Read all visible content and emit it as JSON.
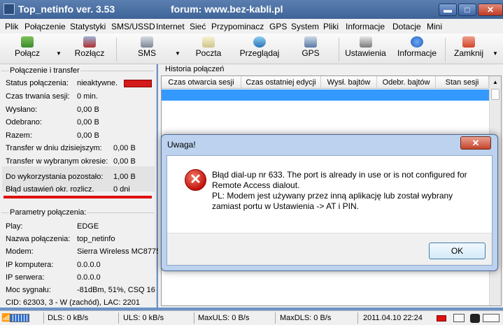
{
  "window": {
    "title": "Top_netinfo ver. 3.53",
    "forum": "forum: www.bez-kabli.pl",
    "min_label": "▬",
    "max_label": "□",
    "close_label": "✕"
  },
  "menu": [
    "Plik",
    "Połączenie",
    "Statystyki",
    "SMS/USSD",
    "Internet",
    "Sieć",
    "Przypominacz",
    "GPS",
    "System",
    "Pliki",
    "Informacje",
    "Dotacje",
    "Mini"
  ],
  "toolbar": {
    "connect": "Połącz",
    "disconnect": "Rozłącz",
    "sms": "SMS",
    "mail": "Poczta",
    "browse": "Przeglądaj",
    "gps": "GPS",
    "settings": "Ustawienia",
    "info": "Informacje",
    "close": "Zamknij"
  },
  "connection": {
    "group_title": "Połączenie i transfer",
    "status_label": "Status połączenia:",
    "status_value": "nieaktywne.",
    "duration_label": "Czas trwania sesji:",
    "duration_value": "0 min.",
    "sent_label": "Wysłano:",
    "sent_value": "0,00 B",
    "received_label": "Odebrano:",
    "received_value": "0,00 B",
    "total_label": "Razem:",
    "total_value": "0,00 B",
    "today_label": "Transfer w dniu dzisiejszym:",
    "today_value": "0,00 B",
    "period_label": "Transfer w wybranym okresie:",
    "period_value": "0,00 B",
    "remaining_label": "Do wykorzystania pozostało:",
    "remaining_value": "1,00 B",
    "error_label": "Błąd ustawień okr. rozlicz.",
    "error_value": "0 dni",
    "status_color": "#d41a1a"
  },
  "params": {
    "group_title": "Parametry połączenia:",
    "play_label": "Play:",
    "play_value": "EDGE",
    "name_label": "Nazwa połączenia:",
    "name_value": "top_netinfo",
    "modem_label": "Modem:",
    "modem_value": "Sierra Wireless MC8775",
    "ip_pc_label": "IP komputera:",
    "ip_pc_value": "0.0.0.0",
    "ip_srv_label": "IP serwera:",
    "ip_srv_value": "0.0.0.0",
    "signal_label": "Moc sygnału:",
    "signal_value": "-81dBm, 51%, CSQ 16",
    "cid": "CID: 62303, 3 - W (zachód), LAC: 2201"
  },
  "history": {
    "title": "Historia połączeń",
    "columns": [
      "Czas otwarcia sesji",
      "Czas ostatniej edycji",
      "Wysł. bajtów",
      "Odebr. bajtów",
      "Stan sesji"
    ]
  },
  "statusbar": {
    "dls": "DLS: 0 kB/s",
    "uls": "ULS: 0 kB/s",
    "max_uls": "MaxULS: 0 B/s",
    "max_dls": "MaxDLS: 0 B/s",
    "datetime": "2011.04.10  22:24"
  },
  "dialog": {
    "title": "Uwaga!",
    "close_label": "✕",
    "icon_glyph": "✕",
    "line1": "Błąd dial-up nr 633. The port is already in use or is not configured for",
    "line2": "Remote Access dialout.",
    "line3": "PL: Modem jest używany przez inną aplikację lub został wybrany",
    "line4": "zamiast portu w Ustawienia -> AT i PIN.",
    "ok": "OK"
  }
}
